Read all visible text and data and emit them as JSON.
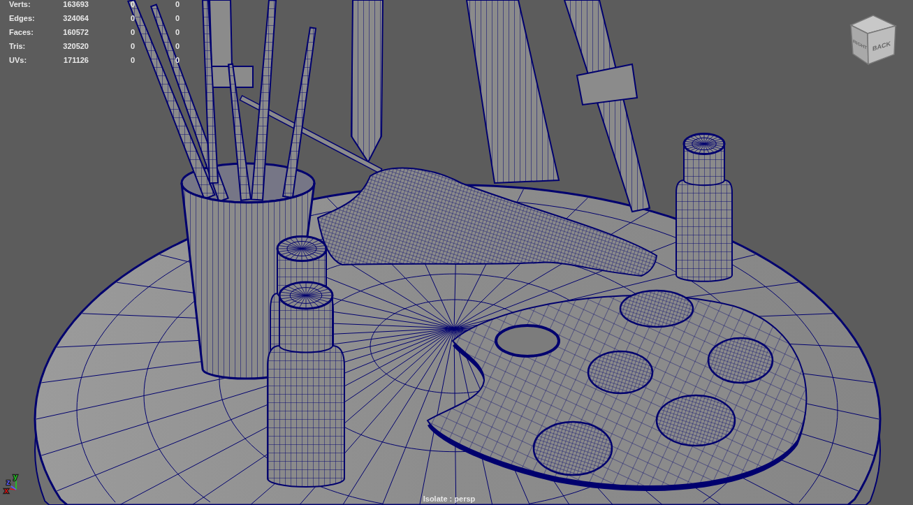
{
  "hud_stats": {
    "rows": [
      {
        "label": "Verts:",
        "value": "163693",
        "column_3": "0",
        "column_4": "0"
      },
      {
        "label": "Edges:",
        "value": "324064",
        "column_3": "0",
        "column_4": "0"
      },
      {
        "label": "Faces:",
        "value": "160572",
        "column_3": "0",
        "column_4": "0"
      },
      {
        "label": "Tris:",
        "value": "320520",
        "column_3": "0",
        "column_4": "0"
      },
      {
        "label": "UVs:",
        "value": "171126",
        "column_3": "0",
        "column_4": "0"
      }
    ]
  },
  "view_cube": {
    "faces": [
      {
        "label": "RIGHT"
      },
      {
        "label": "BACK"
      }
    ]
  },
  "axis_indicator": {
    "axes": [
      {
        "label": "x",
        "color": "#e01010"
      },
      {
        "label": "y",
        "color": "#20d020"
      },
      {
        "label": "z",
        "color": "#5a5aff"
      }
    ]
  },
  "panel_label": "Isolate : persp"
}
